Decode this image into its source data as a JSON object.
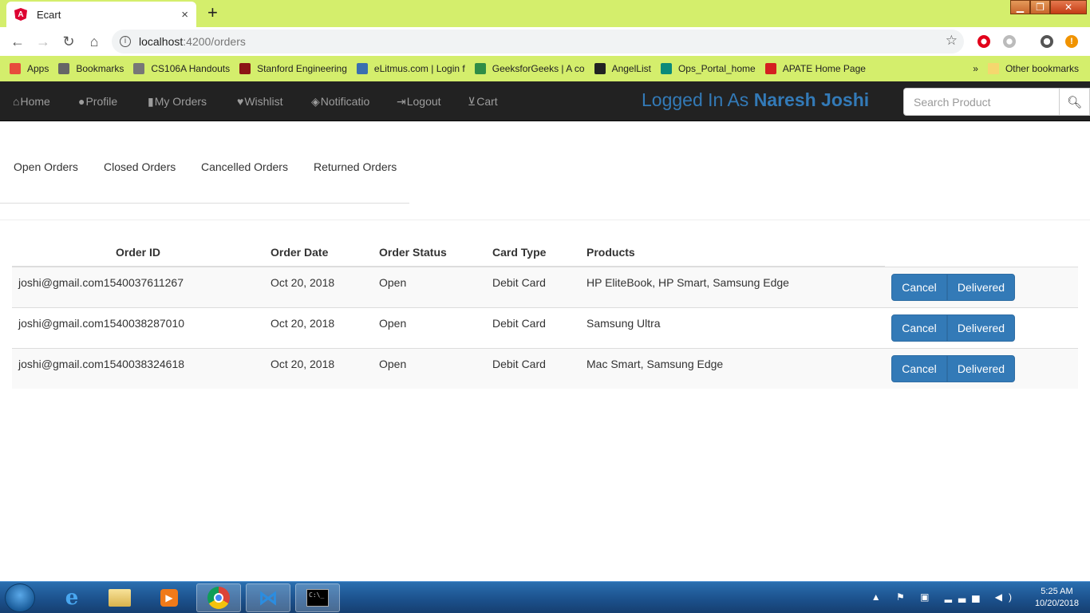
{
  "browser": {
    "tab_title": "Ecart",
    "tab_close": "×",
    "new_tab": "+",
    "url_host": "localhost",
    "url_path": ":4200/orders",
    "bookmarks": [
      {
        "label": "Apps",
        "icon": "apps-grid-icon",
        "color": "#e74c3c"
      },
      {
        "label": "Bookmarks",
        "icon": "star-icon",
        "color": "#666"
      },
      {
        "label": "CS106A Handouts",
        "icon": "page-icon",
        "color": "#777"
      },
      {
        "label": "Stanford Engineering",
        "icon": "stanford-s-icon",
        "color": "#8c1515"
      },
      {
        "label": "eLitmus.com | Login f",
        "icon": "elitmus-icon",
        "color": "#3a6fb0"
      },
      {
        "label": "GeeksforGeeks | A co",
        "icon": "gfg-icon",
        "color": "#2f8d46"
      },
      {
        "label": "AngelList",
        "icon": "angellist-icon",
        "color": "#222"
      },
      {
        "label": "Ops_Portal_home",
        "icon": "sharepoint-icon",
        "color": "#0b8a7a"
      },
      {
        "label": "APATE Home Page",
        "icon": "apate-icon",
        "color": "#d42020"
      }
    ],
    "more_bookmarks": "»",
    "other_bookmarks": "Other bookmarks"
  },
  "navbar": {
    "items": [
      {
        "label": "Home",
        "glyph": "⌂"
      },
      {
        "label": "Profile",
        "glyph": "👤"
      },
      {
        "label": "My Orders",
        "glyph": "▮"
      },
      {
        "label": "Wishlist",
        "glyph": "♥"
      },
      {
        "label": "Notificatio",
        "glyph": "🏷"
      },
      {
        "label": "Logout",
        "glyph": "⇥"
      },
      {
        "label": "Cart",
        "glyph": "🛒"
      }
    ],
    "logged_prefix": "Logged In As ",
    "logged_user": "Naresh Joshi",
    "search_placeholder": "Search Product"
  },
  "order_tabs": [
    "Open Orders",
    "Closed Orders",
    "Cancelled Orders",
    "Returned Orders"
  ],
  "table": {
    "headers": [
      "Order ID",
      "Order Date",
      "Order Status",
      "Card Type",
      "Products"
    ],
    "rows": [
      {
        "order_id": "joshi@gmail.com1540037611267",
        "date": "Oct 20, 2018",
        "status": "Open",
        "card": "Debit Card",
        "products": "HP EliteBook, HP Smart, Samsung Edge"
      },
      {
        "order_id": "joshi@gmail.com1540038287010",
        "date": "Oct 20, 2018",
        "status": "Open",
        "card": "Debit Card",
        "products": "Samsung Ultra"
      },
      {
        "order_id": "joshi@gmail.com1540038324618",
        "date": "Oct 20, 2018",
        "status": "Open",
        "card": "Debit Card",
        "products": "Mac Smart, Samsung Edge"
      }
    ],
    "cancel_label": "Cancel",
    "delivered_label": "Delivered"
  },
  "taskbar": {
    "time": "5:25 AM",
    "date": "10/20/2018"
  }
}
